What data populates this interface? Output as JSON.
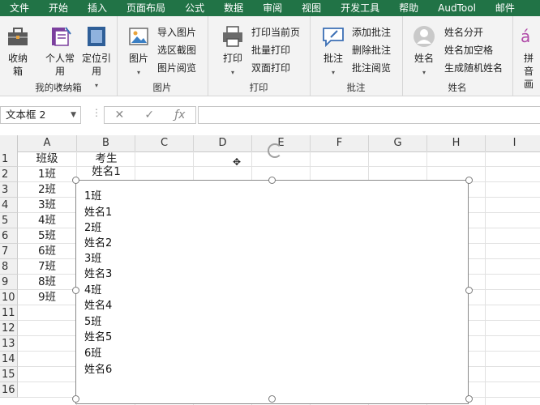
{
  "menu": {
    "tabs": [
      "文件",
      "开始",
      "插入",
      "页面布局",
      "公式",
      "数据",
      "审阅",
      "视图",
      "开发工具",
      "帮助",
      "AudTool",
      "邮件"
    ]
  },
  "ribbon": {
    "groups": {
      "collect": {
        "label": "我的收纳箱",
        "buttons": {
          "storage": "收纳箱",
          "personal": "个人常用",
          "position": "定位引用"
        }
      },
      "picture": {
        "label": "图片",
        "big": "图片",
        "import": "导入图片",
        "screenshot": "选区截图",
        "browse": "图片阅览"
      },
      "print": {
        "label": "打印",
        "big": "打印",
        "current_page": "打印当前页",
        "batch": "批量打印",
        "duplex": "双面打印"
      },
      "comment": {
        "label": "批注",
        "big": "批注",
        "add": "添加批注",
        "delete": "删除批注",
        "browse": "批注阅览"
      },
      "name": {
        "label": "姓名",
        "big": "姓名",
        "split": "姓名分开",
        "add_space": "姓名加空格",
        "random": "生成随机姓名"
      },
      "pinyin": {
        "big": "拼音画"
      }
    }
  },
  "formula_bar": {
    "name_box": "文本框 2",
    "formula_value": ""
  },
  "sheet": {
    "columns": [
      "A",
      "B",
      "C",
      "D",
      "E",
      "F",
      "G",
      "H",
      "I"
    ],
    "rows": [
      "1",
      "2",
      "3",
      "4",
      "5",
      "6",
      "7",
      "8",
      "9",
      "10",
      "11",
      "12",
      "13",
      "14",
      "15",
      "16"
    ],
    "col_a": [
      "班级",
      "1班",
      "2班",
      "3班",
      "4班",
      "5班",
      "6班",
      "7班",
      "8班",
      "9班"
    ],
    "col_b": [
      "考生",
      "姓名1"
    ]
  },
  "textbox": {
    "lines": [
      "1班",
      "姓名1",
      "2班",
      "姓名2",
      "3班",
      "姓名3",
      "4班",
      "姓名4",
      "5班",
      "姓名5",
      "6班",
      "姓名6"
    ]
  },
  "colors": {
    "menu_bar": "#217346",
    "ribbon_bg": "#f3f3f3",
    "header_bg": "#f0f0f0"
  }
}
